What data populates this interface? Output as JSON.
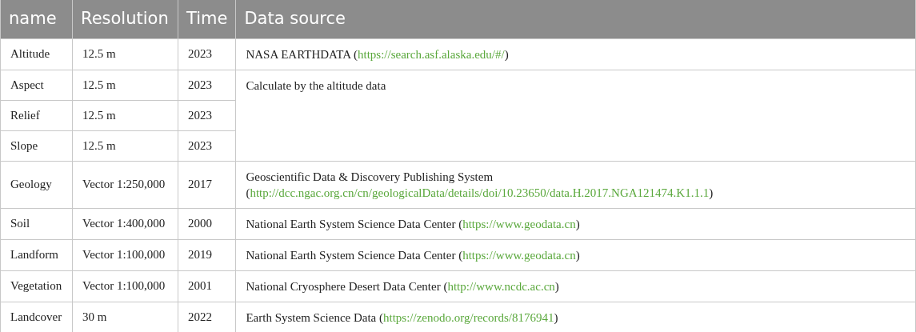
{
  "table": {
    "columns": [
      "name",
      "Resolution",
      "Time",
      "Data source"
    ],
    "rows": [
      {
        "name": "Altitude",
        "resolution": "12.5 m",
        "time": "2023",
        "source": {
          "text": "NASA EARTHDATA (",
          "link": "https://search.asf.alaska.edu/#/",
          "after": ")"
        }
      },
      {
        "name": "Aspect",
        "resolution": "12.5 m",
        "time": "2023",
        "source": {
          "text": "Calculate by the altitude data"
        }
      },
      {
        "name": "Relief",
        "resolution": "12.5 m",
        "time": "2023"
      },
      {
        "name": "Slope",
        "resolution": "12.5 m",
        "time": "2023"
      },
      {
        "name": "Geology",
        "resolution": "Vector 1:250,000",
        "time": "2017",
        "source": {
          "text": "Geoscientific Data & Discovery Publishing System (",
          "link": "http://dcc.ngac.org.cn/cn/geologicalData/details/doi/10.23650/data.H.2017.NGA121474.K1.1.1",
          "after": ")"
        }
      },
      {
        "name": "Soil",
        "resolution": "Vector 1:400,000",
        "time": "2000",
        "source": {
          "text": "National Earth System Science Data Center (",
          "link": "https://www.geodata.cn",
          "after": ")"
        }
      },
      {
        "name": "Landform",
        "resolution": "Vector 1:100,000",
        "time": "2019",
        "source": {
          "text": "National Earth System Science Data Center (",
          "link": "https://www.geodata.cn",
          "after": ")"
        }
      },
      {
        "name": "Vegetation",
        "resolution": "Vector 1:100,000",
        "time": "2001",
        "source": {
          "text": "National Cryosphere Desert Data Center (",
          "link": "http://www.ncdc.ac.cn",
          "after": ")"
        }
      },
      {
        "name": "Landcover",
        "resolution": "30 m",
        "time": "2022",
        "source": {
          "text": "Earth System Science Data (",
          "link": "https://zenodo.org/records/8176941",
          "after": ")"
        }
      }
    ]
  }
}
